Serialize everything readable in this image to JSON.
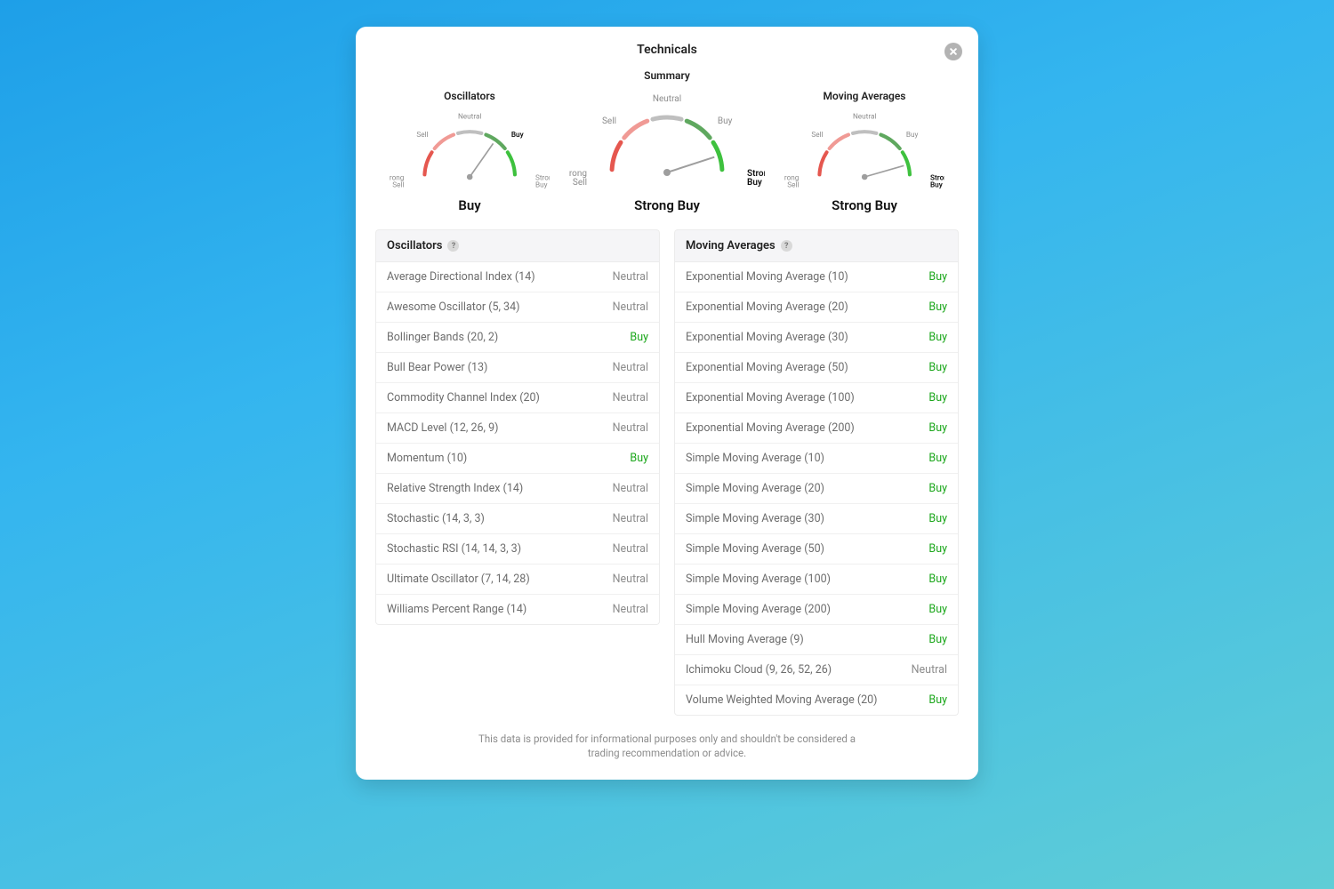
{
  "title": "Technicals",
  "gauges": [
    {
      "title": "Oscillators",
      "verdict": "Buy",
      "angle": 35,
      "bold": "Buy",
      "scale": 0.82
    },
    {
      "title": "Summary",
      "verdict": "Strong Buy",
      "angle": 72,
      "bold": "Strong Buy",
      "scale": 1.0
    },
    {
      "title": "Moving Averages",
      "verdict": "Strong Buy",
      "angle": 74,
      "bold": "Strong Buy",
      "scale": 0.82
    }
  ],
  "gauge_labels": {
    "strong_sell": "Strong\nSell",
    "sell": "Sell",
    "neutral": "Neutral",
    "buy": "Buy",
    "strong_buy": "Strong\nBuy"
  },
  "oscillators": {
    "header": "Oscillators",
    "rows": [
      {
        "name": "Average Directional Index (14)",
        "value": "Neutral",
        "tone": "neutral"
      },
      {
        "name": "Awesome Oscillator (5, 34)",
        "value": "Neutral",
        "tone": "neutral"
      },
      {
        "name": "Bollinger Bands (20, 2)",
        "value": "Buy",
        "tone": "buy"
      },
      {
        "name": "Bull Bear Power (13)",
        "value": "Neutral",
        "tone": "neutral"
      },
      {
        "name": "Commodity Channel Index (20)",
        "value": "Neutral",
        "tone": "neutral"
      },
      {
        "name": "MACD Level (12, 26, 9)",
        "value": "Neutral",
        "tone": "neutral"
      },
      {
        "name": "Momentum (10)",
        "value": "Buy",
        "tone": "buy"
      },
      {
        "name": "Relative Strength Index (14)",
        "value": "Neutral",
        "tone": "neutral"
      },
      {
        "name": "Stochastic (14, 3, 3)",
        "value": "Neutral",
        "tone": "neutral"
      },
      {
        "name": "Stochastic RSI (14, 14, 3, 3)",
        "value": "Neutral",
        "tone": "neutral"
      },
      {
        "name": "Ultimate Oscillator (7, 14, 28)",
        "value": "Neutral",
        "tone": "neutral"
      },
      {
        "name": "Williams Percent Range (14)",
        "value": "Neutral",
        "tone": "neutral"
      }
    ]
  },
  "moving_averages": {
    "header": "Moving Averages",
    "rows": [
      {
        "name": "Exponential Moving Average (10)",
        "value": "Buy",
        "tone": "buy"
      },
      {
        "name": "Exponential Moving Average (20)",
        "value": "Buy",
        "tone": "buy"
      },
      {
        "name": "Exponential Moving Average (30)",
        "value": "Buy",
        "tone": "buy"
      },
      {
        "name": "Exponential Moving Average (50)",
        "value": "Buy",
        "tone": "buy"
      },
      {
        "name": "Exponential Moving Average (100)",
        "value": "Buy",
        "tone": "buy"
      },
      {
        "name": "Exponential Moving Average (200)",
        "value": "Buy",
        "tone": "buy"
      },
      {
        "name": "Simple Moving Average (10)",
        "value": "Buy",
        "tone": "buy"
      },
      {
        "name": "Simple Moving Average (20)",
        "value": "Buy",
        "tone": "buy"
      },
      {
        "name": "Simple Moving Average (30)",
        "value": "Buy",
        "tone": "buy"
      },
      {
        "name": "Simple Moving Average (50)",
        "value": "Buy",
        "tone": "buy"
      },
      {
        "name": "Simple Moving Average (100)",
        "value": "Buy",
        "tone": "buy"
      },
      {
        "name": "Simple Moving Average (200)",
        "value": "Buy",
        "tone": "buy"
      },
      {
        "name": "Hull Moving Average (9)",
        "value": "Buy",
        "tone": "buy"
      },
      {
        "name": "Ichimoku Cloud (9, 26, 52, 26)",
        "value": "Neutral",
        "tone": "neutral"
      },
      {
        "name": "Volume Weighted Moving Average (20)",
        "value": "Buy",
        "tone": "buy"
      }
    ]
  },
  "disclaimer": "This data is provided for informational purposes only and shouldn't be considered a trading recommendation or advice.",
  "chart_data": [
    {
      "type": "gauge",
      "title": "Oscillators",
      "categories": [
        "Strong Sell",
        "Sell",
        "Neutral",
        "Buy",
        "Strong Buy"
      ],
      "needle_angle_deg": 35,
      "value": "Buy",
      "scale_deg": [
        -90,
        90
      ]
    },
    {
      "type": "gauge",
      "title": "Summary",
      "categories": [
        "Strong Sell",
        "Sell",
        "Neutral",
        "Buy",
        "Strong Buy"
      ],
      "needle_angle_deg": 72,
      "value": "Strong Buy",
      "scale_deg": [
        -90,
        90
      ]
    },
    {
      "type": "gauge",
      "title": "Moving Averages",
      "categories": [
        "Strong Sell",
        "Sell",
        "Neutral",
        "Buy",
        "Strong Buy"
      ],
      "needle_angle_deg": 74,
      "value": "Strong Buy",
      "scale_deg": [
        -90,
        90
      ]
    }
  ]
}
